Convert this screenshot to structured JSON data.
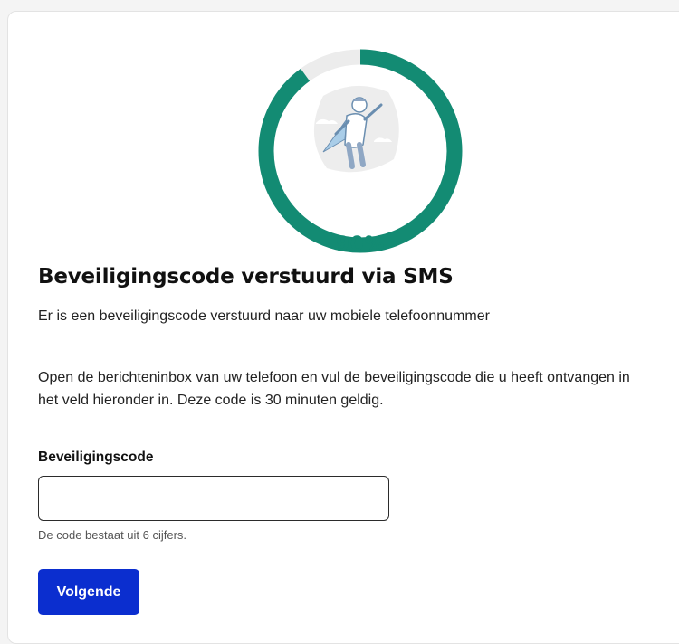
{
  "progress": {
    "percent": 90,
    "label": "90%"
  },
  "illustration": {
    "icon": "flying-hero-illustration"
  },
  "content": {
    "title": "Beveiligingscode verstuurd via SMS",
    "intro": "Er is een beveiligingscode verstuurd naar uw mobiele telefoonnummer",
    "instructions": "Open de berichteninbox van uw telefoon en vul de beveiligingscode die u heeft ontvangen in het veld hieronder in. Deze code is 30 minuten geldig."
  },
  "form": {
    "code_label": "Beveiligingscode",
    "code_value": "",
    "code_hint": "De code bestaat uit 6 cijfers.",
    "next_label": "Volgende"
  },
  "colors": {
    "progress": "#138b73",
    "track": "#ececec",
    "button": "#0b2ecf"
  }
}
